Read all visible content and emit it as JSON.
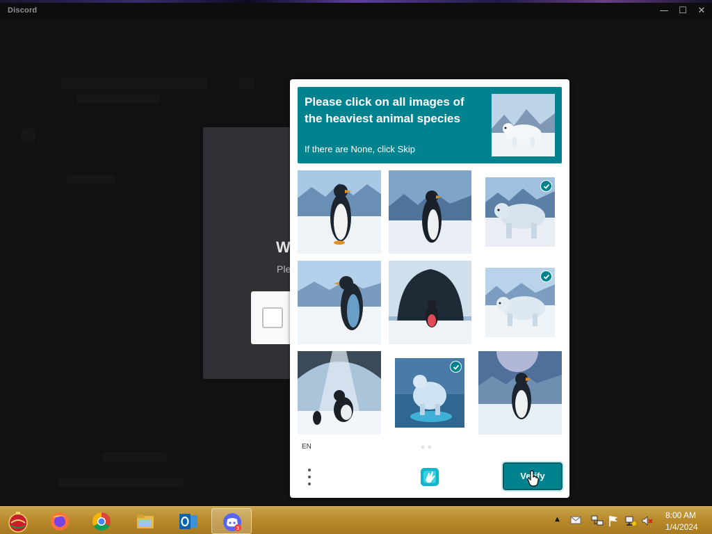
{
  "window": {
    "app_title": "Discord",
    "controls": {
      "minimize": "—",
      "maximize": "☐",
      "close": "✕"
    }
  },
  "background_modal": {
    "title_partial": "W",
    "subtitle_partial": "Ple"
  },
  "captcha": {
    "prompt": "Please click on all images of the heaviest animal species",
    "prompt_hint": "If there are None, click Skip",
    "tiles": [
      {
        "subject": "penguin",
        "selected": false
      },
      {
        "subject": "penguin",
        "selected": false
      },
      {
        "subject": "polar-bear",
        "selected": true
      },
      {
        "subject": "penguin",
        "selected": false
      },
      {
        "subject": "penguin-in-ice-cave",
        "selected": false
      },
      {
        "subject": "polar-bear",
        "selected": true
      },
      {
        "subject": "penguin-in-ice-cave",
        "selected": false
      },
      {
        "subject": "polar-bear",
        "selected": true
      },
      {
        "subject": "penguin",
        "selected": false
      }
    ],
    "language": "EN",
    "verify_label": "Verify",
    "accent_color": "#00838f"
  },
  "taskbar": {
    "items": [
      "start-orb",
      "firefox",
      "chrome",
      "file-explorer",
      "outlook",
      "discord"
    ],
    "discord_badge": "3",
    "tray_arrow": "▲",
    "clock_time": "8:00 AM",
    "clock_date": "1/4/2024"
  }
}
